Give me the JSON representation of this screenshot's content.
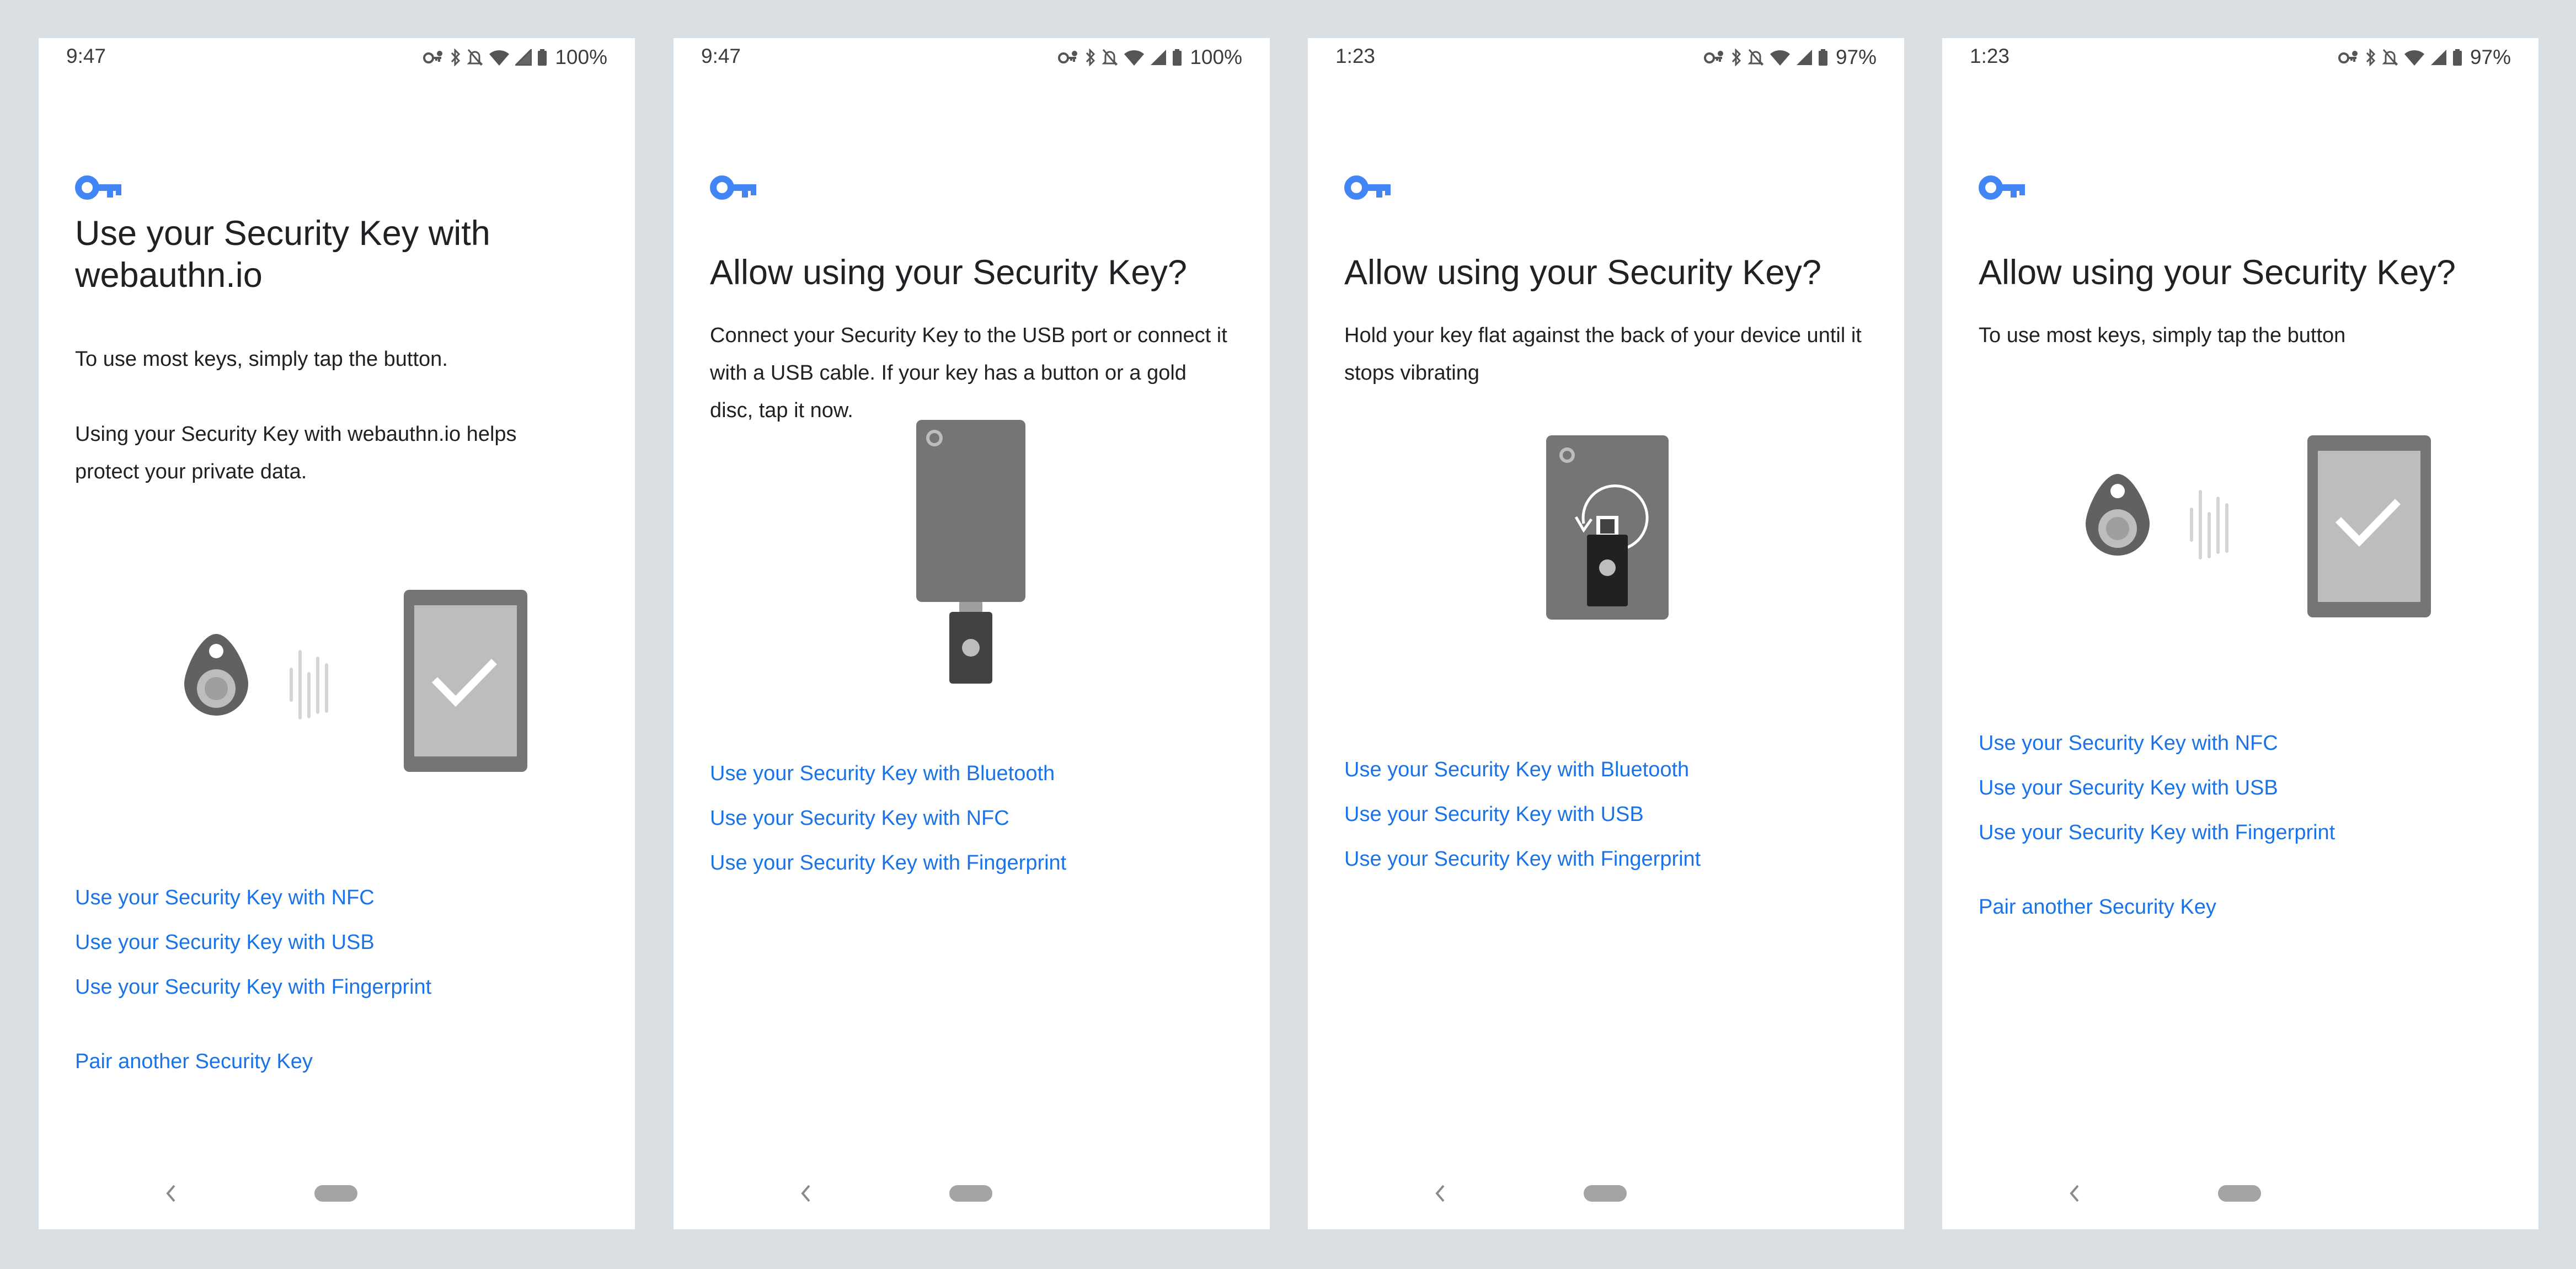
{
  "colors": {
    "link": "#1a73e8",
    "accent": "#4285f4",
    "frame": "#dadfe3"
  },
  "screens": [
    {
      "status": {
        "time": "9:47",
        "battery": "100%"
      },
      "title": "Use your Security Key with webauthn.io",
      "body": [
        "To use most keys, simply tap the button.",
        "Using your Security Key with webauthn.io helps protect your private data."
      ],
      "illustration": "nfc-tap",
      "links": [
        "Use your Security Key with NFC",
        "Use your Security Key with USB",
        "Use your Security Key with Fingerprint"
      ],
      "pair_link": "Pair another Security Key"
    },
    {
      "status": {
        "time": "9:47",
        "battery": "100%"
      },
      "title": "Allow using your Security Key?",
      "body": [
        "Connect your Security Key to the USB port or connect it with a USB cable. If your key has a button or a gold disc, tap it now."
      ],
      "illustration": "usb-plug",
      "links": [
        "Use your Security Key with Bluetooth",
        "Use your Security Key with NFC",
        "Use your Security Key with Fingerprint"
      ]
    },
    {
      "status": {
        "time": "1:23",
        "battery": "97%"
      },
      "title": "Allow using your Security Key?",
      "body": [
        "Hold your key flat against the back of your device until it stops vibrating"
      ],
      "illustration": "usb-back",
      "links": [
        "Use your Security Key with Bluetooth",
        "Use your Security Key with USB",
        "Use your Security Key with Fingerprint"
      ]
    },
    {
      "status": {
        "time": "1:23",
        "battery": "97%"
      },
      "title": "Allow using your Security Key?",
      "body": [
        "To use most keys, simply tap the button"
      ],
      "illustration": "nfc-tap",
      "links": [
        "Use your Security Key with NFC",
        "Use your Security Key with USB",
        "Use your Security Key with Fingerprint"
      ],
      "pair_link": "Pair another Security Key"
    }
  ]
}
